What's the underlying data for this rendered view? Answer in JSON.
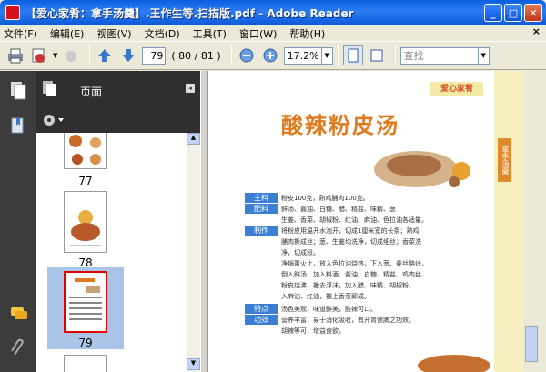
{
  "window": {
    "title": "【爱心家肴：拿手汤羹】.王作生等.扫描版.pdf - Adobe Reader"
  },
  "menu": {
    "items": [
      "文件(F)",
      "编辑(E)",
      "视图(V)",
      "文档(D)",
      "工具(T)",
      "窗口(W)",
      "帮助(H)"
    ],
    "close": "×"
  },
  "toolbar": {
    "page": "79",
    "page_count": "( 80 / 81 )",
    "zoom": "17.2%",
    "search_placeholder": "查找"
  },
  "panel": {
    "title": "页面"
  },
  "thumbnails": [
    {
      "label": "77"
    },
    {
      "label": "78"
    },
    {
      "label": "79"
    }
  ],
  "document": {
    "brand": "爱心家肴",
    "series": "拿手汤羹",
    "recipe_title": "酸辣粉皮汤",
    "rows": [
      {
        "badge": "主料",
        "text": "粉皮100克，熟鸡脯肉100克。"
      },
      {
        "badge": "配料",
        "text": "鲜汤、酱油、白糖、醋、精盐、味精、葱"
      },
      {
        "badge": "",
        "text": "生姜、香菜、胡椒粉、红油、麻油、色拉油各适量。"
      },
      {
        "badge": "制作",
        "text": "将粉皮用温开水泡开，切成1厘米宽的长条；熟鸡"
      },
      {
        "badge": "",
        "text": "脯肉撕成丝；葱、生姜均洗净，切成细丝；香菜洗"
      },
      {
        "badge": "",
        "text": "净，切成段。"
      },
      {
        "badge": "",
        "text": "净锅置火上，放入色拉油烧热，下入葱、姜丝略炒，"
      },
      {
        "badge": "",
        "text": "倒入鲜汤，加入料酒、酱油、白糖、精盐、鸡肉丝、"
      },
      {
        "badge": "",
        "text": "粉皮烧沸，撇去浮沫，加入醋、味精、胡椒粉、"
      },
      {
        "badge": "",
        "text": "入麻油、红油，撒上香菜即成。"
      },
      {
        "badge": "特点",
        "text": "汤色美观，味道鲜美，酸辣可口。"
      },
      {
        "badge": "功效",
        "text": "营养丰富，易于消化吸收，有开胃健脾之功效。"
      },
      {
        "badge": "",
        "text": "胡辣等可，增益食欲。"
      }
    ]
  }
}
